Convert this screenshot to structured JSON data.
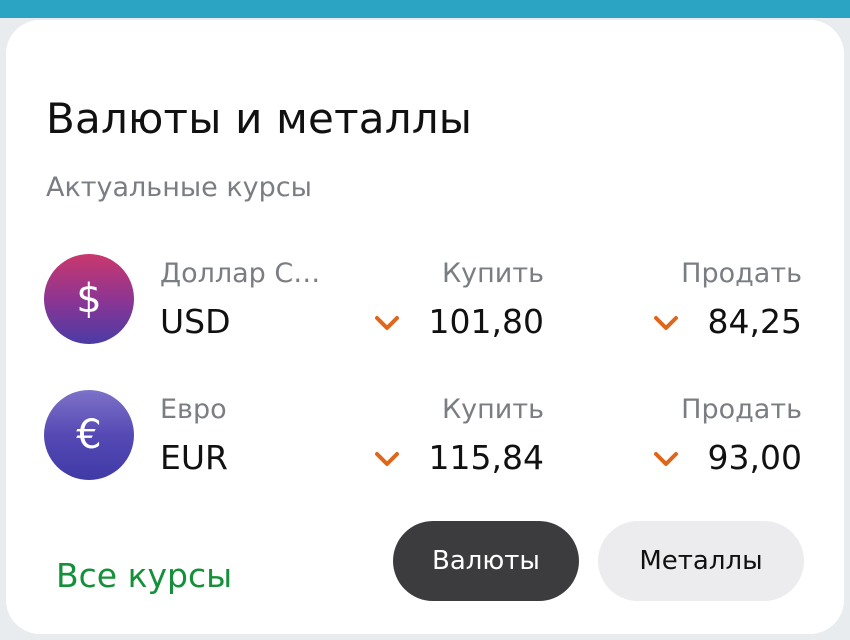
{
  "card": {
    "title": "Валюты и металлы",
    "subtitle": "Актуальные курсы"
  },
  "rates": [
    {
      "icon": "dollar-sign-icon",
      "symbol": "$",
      "name": "Доллар США",
      "code": "USD",
      "buy_label": "Купить",
      "buy_value": "101,80",
      "buy_trend": "down",
      "sell_label": "Продать",
      "sell_value": "84,25",
      "sell_trend": "down"
    },
    {
      "icon": "euro-sign-icon",
      "symbol": "€",
      "name": "Евро",
      "code": "EUR",
      "buy_label": "Купить",
      "buy_value": "115,84",
      "buy_trend": "down",
      "sell_label": "Продать",
      "sell_value": "93,00",
      "sell_trend": "down"
    }
  ],
  "footer": {
    "all_rates_link": "Все курсы",
    "tabs": [
      "Валюты",
      "Металлы"
    ],
    "active_tab": "Валюты"
  },
  "colors": {
    "accent_green": "#15903a",
    "trend_down": "#e0661c",
    "active_tab_bg": "#3c3c3e",
    "top_bar": "#2aa4c2"
  }
}
